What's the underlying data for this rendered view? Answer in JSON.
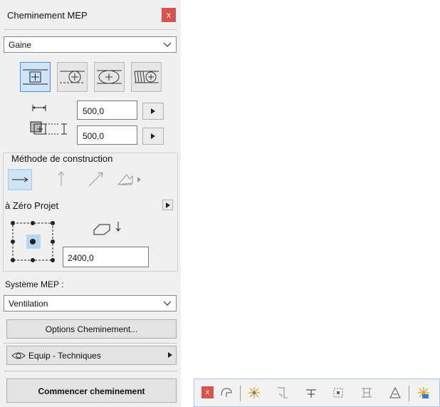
{
  "panel": {
    "title": "Cheminement MEP",
    "close_label": "x",
    "type_select": {
      "value": "Gaine"
    },
    "size": {
      "width": "500,0",
      "height": "500,0"
    },
    "construction": {
      "label": "Méthode de construction"
    },
    "reference": {
      "label": "à Zéro Projet",
      "offset": "2400,0"
    },
    "system": {
      "label": "Système MEP :",
      "value": "Ventilation"
    },
    "options_button": "Options Cheminement...",
    "layer_button": "Equip - Techniques",
    "start_button": "Commencer cheminement"
  },
  "toolbar": {
    "close_label": "x",
    "icons": [
      "route-icon",
      "connector-icon",
      "elbow-icon",
      "branch-icon",
      "reducer-icon",
      "transition-icon",
      "bend-icon",
      "insert-icon"
    ]
  },
  "colors": {
    "accent": "#4d90d8",
    "selected_bg": "#cfe3f6",
    "close_red": "#d9534f"
  }
}
